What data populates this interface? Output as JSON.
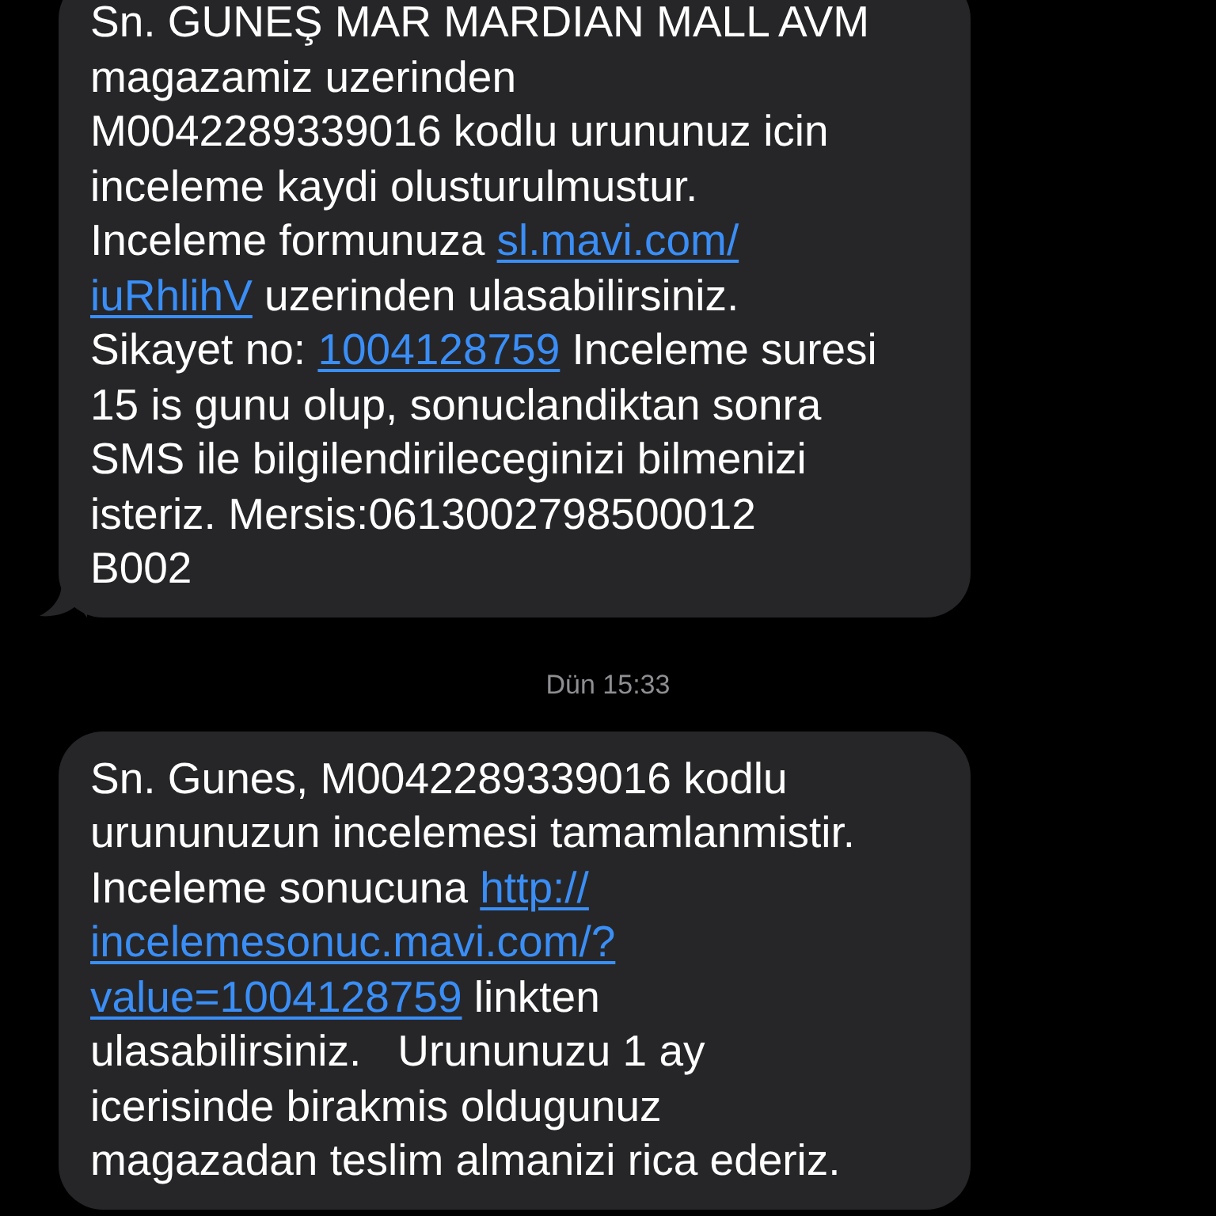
{
  "messages": [
    {
      "tail": true,
      "lines": [
        [
          {
            "kind": "text",
            "text": "Sn. GUNEŞ MAR MARDIAN MALL AVM"
          }
        ],
        [
          {
            "kind": "text",
            "text": "magazamiz uzerinden"
          }
        ],
        [
          {
            "kind": "text",
            "text": "M0042289339016 kodlu urununuz icin"
          }
        ],
        [
          {
            "kind": "text",
            "text": "inceleme kaydi olusturulmustur."
          }
        ],
        [
          {
            "kind": "text",
            "text": "Inceleme formunuza "
          },
          {
            "kind": "link",
            "text": "sl.mavi.com/"
          }
        ],
        [
          {
            "kind": "link",
            "text": "iuRhlihV"
          },
          {
            "kind": "text",
            "text": " uzerinden ulasabilirsiniz."
          }
        ],
        [
          {
            "kind": "text",
            "text": "Sikayet no: "
          },
          {
            "kind": "link",
            "text": "1004128759"
          },
          {
            "kind": "text",
            "text": " Inceleme suresi"
          }
        ],
        [
          {
            "kind": "text",
            "text": "15 is gunu olup, sonuclandiktan sonra"
          }
        ],
        [
          {
            "kind": "text",
            "text": "SMS ile bilgilendirileceginizi bilmenizi"
          }
        ],
        [
          {
            "kind": "text",
            "text": "isteriz. Mersis:0613002798500012"
          }
        ],
        [
          {
            "kind": "text",
            "text": "B002"
          }
        ]
      ]
    },
    {
      "time": "Dün 15:33"
    },
    {
      "tail": false,
      "lines": [
        [
          {
            "kind": "text",
            "text": "Sn. Gunes, M0042289339016 kodlu"
          }
        ],
        [
          {
            "kind": "text",
            "text": "urununuzun incelemesi tamamlanmistir."
          }
        ],
        [
          {
            "kind": "text",
            "text": "Inceleme sonucuna "
          },
          {
            "kind": "link",
            "text": "http://"
          }
        ],
        [
          {
            "kind": "link",
            "text": "incelemesonuc.mavi.com/?"
          }
        ],
        [
          {
            "kind": "link",
            "text": "value=1004128759"
          },
          {
            "kind": "text",
            "text": " linkten"
          }
        ],
        [
          {
            "kind": "text",
            "text": "ulasabilirsiniz.   Urununuzu 1 ay"
          }
        ],
        [
          {
            "kind": "text",
            "text": "icerisinde birakmis oldugunuz"
          }
        ],
        [
          {
            "kind": "text",
            "text": "magazadan teslim almanizi rica ederiz."
          }
        ]
      ]
    }
  ]
}
